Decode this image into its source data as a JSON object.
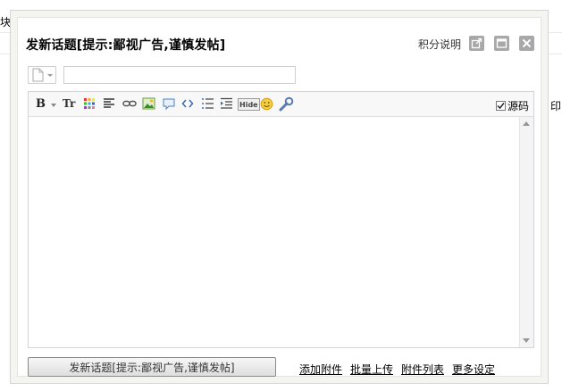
{
  "background": {
    "left_fragment": "块",
    "right_fragment": "印"
  },
  "dialog": {
    "title": "发新话题[提示:鄙视广告,谨慎发帖]",
    "help_link": "积分说明"
  },
  "form": {
    "subject_value": "",
    "subject_placeholder": ""
  },
  "toolbar": {
    "bold": "B",
    "font_size": "Tr",
    "hide": "Hide",
    "source_label": "源码",
    "source_checked": true
  },
  "footer": {
    "submit_label": "发新话题[提示:鄙视广告,谨慎发帖]",
    "links": [
      "添加附件",
      "批量上传",
      "附件列表",
      "更多设定"
    ]
  },
  "colors": {
    "dialog_bg": "#f4f4f0",
    "window_button": "#a8a8a8"
  }
}
